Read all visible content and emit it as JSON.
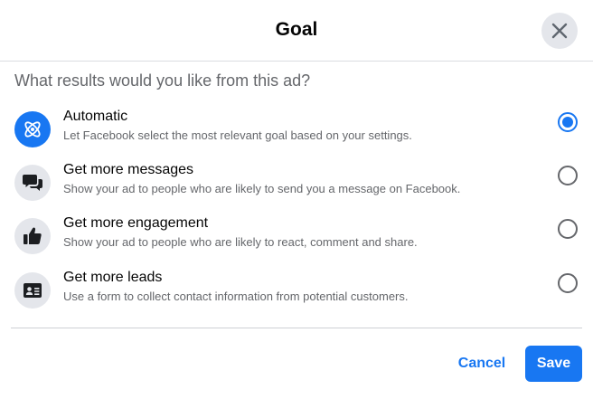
{
  "dialog": {
    "title": "Goal",
    "close_icon": "close-icon",
    "question": "What results would you like from this ad?"
  },
  "options": [
    {
      "title": "Automatic",
      "description": "Let Facebook select the most relevant goal based on your settings.",
      "icon": "atom-icon",
      "selected": true
    },
    {
      "title": "Get more messages",
      "description": "Show your ad to people who are likely to send you a message on Facebook.",
      "icon": "messages-icon",
      "selected": false
    },
    {
      "title": "Get more engagement",
      "description": "Show your ad to people who are likely to react, comment and share.",
      "icon": "thumbs-up-icon",
      "selected": false
    },
    {
      "title": "Get more leads",
      "description": "Use a form to collect contact information from potential customers.",
      "icon": "contact-card-icon",
      "selected": false
    }
  ],
  "footer": {
    "cancel_label": "Cancel",
    "save_label": "Save"
  },
  "colors": {
    "accent": "#1877f2",
    "icon_bg": "#e4e6eb"
  }
}
